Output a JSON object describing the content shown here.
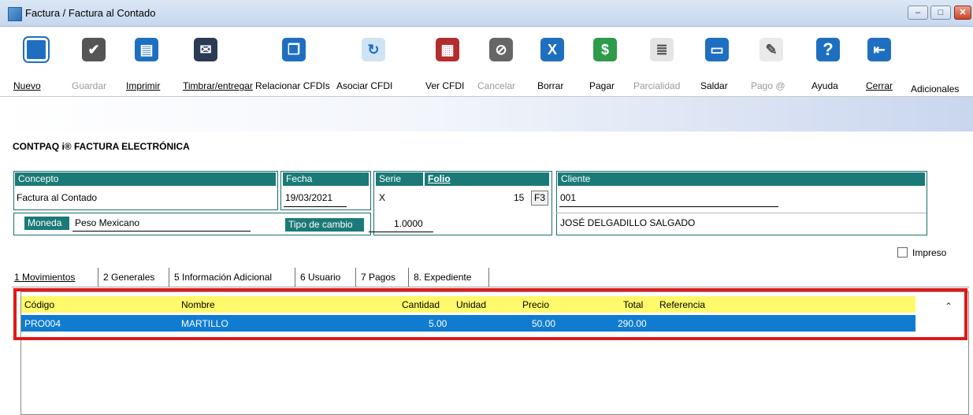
{
  "window": {
    "title": "Factura / Factura al Contado",
    "controls": [
      "–",
      "□",
      "✕"
    ]
  },
  "toolbar": {
    "buttons": [
      {
        "label": "Nuevo",
        "icon": "new-doc-icon",
        "enabled": true
      },
      {
        "label": "Guardar",
        "icon": "checkmark-icon",
        "enabled": false
      },
      {
        "label": "Imprimir",
        "icon": "printer-icon",
        "enabled": true
      },
      {
        "label": "Timbrar/entregar",
        "icon": "stamp-icon",
        "enabled": true
      },
      {
        "label": "Relacionar CFDIs",
        "icon": "related-docs-icon",
        "enabled": true
      },
      {
        "label": "Asociar CFDI",
        "icon": "associate-icon",
        "enabled": true
      },
      {
        "label": "Ver CFDI",
        "icon": "view-cfdi-icon",
        "enabled": true
      },
      {
        "label": "Cancelar",
        "icon": "cancel-icon",
        "enabled": false
      },
      {
        "label": "Borrar",
        "icon": "delete-x-icon",
        "enabled": true
      },
      {
        "label": "Pagar",
        "icon": "pay-icon",
        "enabled": true
      },
      {
        "label": "Parcialidad",
        "icon": "partial-icon",
        "enabled": false
      },
      {
        "label": "Saldar",
        "icon": "settle-icon",
        "enabled": true
      },
      {
        "label": "Pago @",
        "icon": "payment-online-icon",
        "enabled": false
      },
      {
        "label": "Ayuda",
        "icon": "help-icon",
        "enabled": true
      },
      {
        "label": "Cerrar",
        "icon": "exit-door-icon",
        "enabled": true
      }
    ],
    "adicionales": "Adicionales"
  },
  "app_heading": "CONTPAQ i® FACTURA ELECTRÓNICA",
  "form": {
    "concepto_label": "Concepto",
    "concepto": "Factura al Contado",
    "fecha_label": "Fecha",
    "fecha": "19/03/2021",
    "serie_label": "Serie",
    "serie": "X",
    "folio_label": "Folio",
    "folio": "15",
    "f3": "F3",
    "cliente_label": "Cliente",
    "cliente_code": "001",
    "cliente_name": "JOSÉ DELGADILLO SALGADO",
    "moneda_label": "Moneda",
    "moneda": "Peso Mexicano",
    "tipo_cambio_label": "Tipo de cambio",
    "tipo_cambio": "1.0000",
    "impreso_label": "Impreso"
  },
  "tabs": [
    "1 Movimientos",
    "2 Generales",
    "5 Información Adicional",
    "6 Usuario",
    "7 Pagos",
    "8. Expediente"
  ],
  "grid": {
    "columns": [
      "Código",
      "Nombre",
      "Cantidad",
      "Unidad",
      "Precio",
      "Total",
      "Referencia"
    ],
    "rows": [
      {
        "codigo": "PRO004",
        "nombre": "MARTILLO",
        "cantidad": "5.00",
        "unidad": "",
        "precio": "50.00",
        "total": "290.00",
        "referencia": ""
      }
    ]
  },
  "colors": {
    "header_teal": "#1b7a78",
    "grid_header": "#fff96b",
    "selected_row": "#0f7cd1",
    "highlight": "#e01818"
  }
}
